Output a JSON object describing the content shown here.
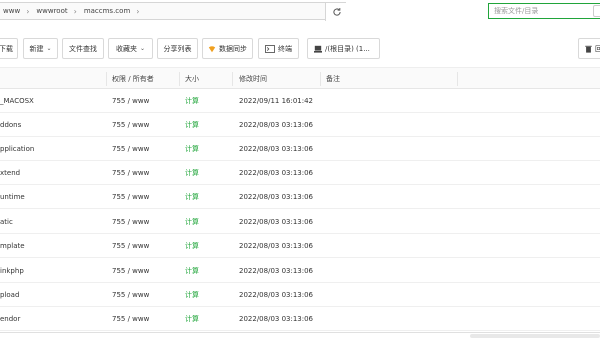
{
  "address_bar": {
    "crumbs": [
      "www",
      "wwwroot",
      "maccms.com"
    ]
  },
  "search": {
    "placeholder": "搜索文件/目录"
  },
  "toolbar": {
    "download_label": "下载",
    "new_label": "新建",
    "file_search_label": "文件查找",
    "favorites_label": "收藏夹",
    "share_list_label": "分享列表",
    "data_sync_label": "数据同步",
    "terminal_label": "终端",
    "root_dir_label": "/(根目录) (1...",
    "recycle_label": "回"
  },
  "table": {
    "headers": {
      "name": "",
      "perm": "权限 / 所有者",
      "size": "大小",
      "modified": "修改时间",
      "note": "备注"
    },
    "rows": [
      {
        "name": "_MACOSX",
        "perm": "755 / www",
        "size": "计算",
        "modified": "2022/09/11 16:01:42",
        "note": ""
      },
      {
        "name": "ddons",
        "perm": "755 / www",
        "size": "计算",
        "modified": "2022/08/03 03:13:06",
        "note": ""
      },
      {
        "name": "pplication",
        "perm": "755 / www",
        "size": "计算",
        "modified": "2022/08/03 03:13:06",
        "note": ""
      },
      {
        "name": "xtend",
        "perm": "755 / www",
        "size": "计算",
        "modified": "2022/08/03 03:13:06",
        "note": ""
      },
      {
        "name": "untime",
        "perm": "755 / www",
        "size": "计算",
        "modified": "2022/08/03 03:13:06",
        "note": ""
      },
      {
        "name": "atic",
        "perm": "755 / www",
        "size": "计算",
        "modified": "2022/08/03 03:13:06",
        "note": ""
      },
      {
        "name": "mplate",
        "perm": "755 / www",
        "size": "计算",
        "modified": "2022/08/03 03:13:06",
        "note": ""
      },
      {
        "name": "inkphp",
        "perm": "755 / www",
        "size": "计算",
        "modified": "2022/08/03 03:13:06",
        "note": ""
      },
      {
        "name": "pload",
        "perm": "755 / www",
        "size": "计算",
        "modified": "2022/08/03 03:13:06",
        "note": ""
      },
      {
        "name": "endor",
        "perm": "755 / www",
        "size": "计算",
        "modified": "2022/08/03 03:13:06",
        "note": ""
      }
    ]
  },
  "colors": {
    "accent": "#20a53a",
    "border": "#d9d9d9",
    "sync_icon": "#f0a020"
  }
}
